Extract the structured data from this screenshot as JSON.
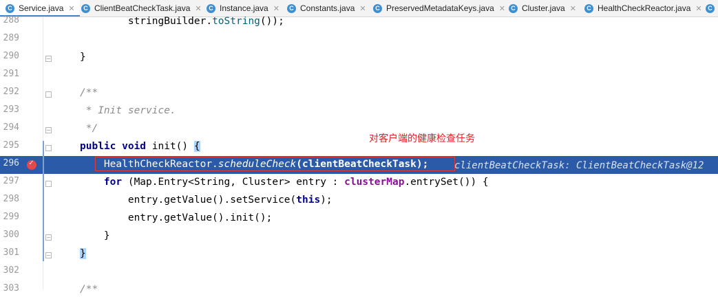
{
  "tabs": [
    {
      "label": "Service.java",
      "active": true
    },
    {
      "label": "ClientBeatCheckTask.java",
      "active": false
    },
    {
      "label": "Instance.java",
      "active": false
    },
    {
      "label": "Constants.java",
      "active": false
    },
    {
      "label": "PreservedMetadataKeys.java",
      "active": false
    },
    {
      "label": "Cluster.java",
      "active": false
    },
    {
      "label": "HealthCheckReactor.java",
      "active": false
    }
  ],
  "tab_icon_letter": "C",
  "close_glyph": "✕",
  "lines": [
    {
      "n": "288"
    },
    {
      "n": "289"
    },
    {
      "n": "290"
    },
    {
      "n": "291"
    },
    {
      "n": "292"
    },
    {
      "n": "293"
    },
    {
      "n": "294"
    },
    {
      "n": "295"
    },
    {
      "n": "296"
    },
    {
      "n": "297"
    },
    {
      "n": "298"
    },
    {
      "n": "299"
    },
    {
      "n": "300"
    },
    {
      "n": "301"
    },
    {
      "n": "302"
    },
    {
      "n": "303"
    }
  ],
  "code": {
    "l288_a": "        stringBuilder.",
    "l288_b": "toString",
    "l288_c": "());",
    "l290": "}",
    "l292": "/**",
    "l293": " * Init service.",
    "l294": " */",
    "l295_kw": "public void ",
    "l295_b": "init() ",
    "l295_brace": "{",
    "l296_a": "    HealthCheckReactor.",
    "l296_b": "scheduleCheck",
    "l296_c": "(clientBeatCheckTask);",
    "l296_inlay": "clientBeatCheckTask: ClientBeatCheckTask@12",
    "l297_kw": "    for ",
    "l297_b": "(Map.Entry<String, Cluster> entry : ",
    "l297_fld": "clusterMap",
    "l297_c": ".entrySet()) {",
    "l298_a": "        entry.getValue().setService(",
    "l298_kw": "this",
    "l298_c": ");",
    "l299": "        entry.getValue().init();",
    "l300": "    }",
    "l301": "}",
    "l303": "/**"
  },
  "annotation": "对客户端的健康检查任务",
  "colors": {
    "selection": "#2a5aa8",
    "annotation": "#e02020",
    "keyword": "#00008b",
    "comment": "#8c8c8c"
  }
}
